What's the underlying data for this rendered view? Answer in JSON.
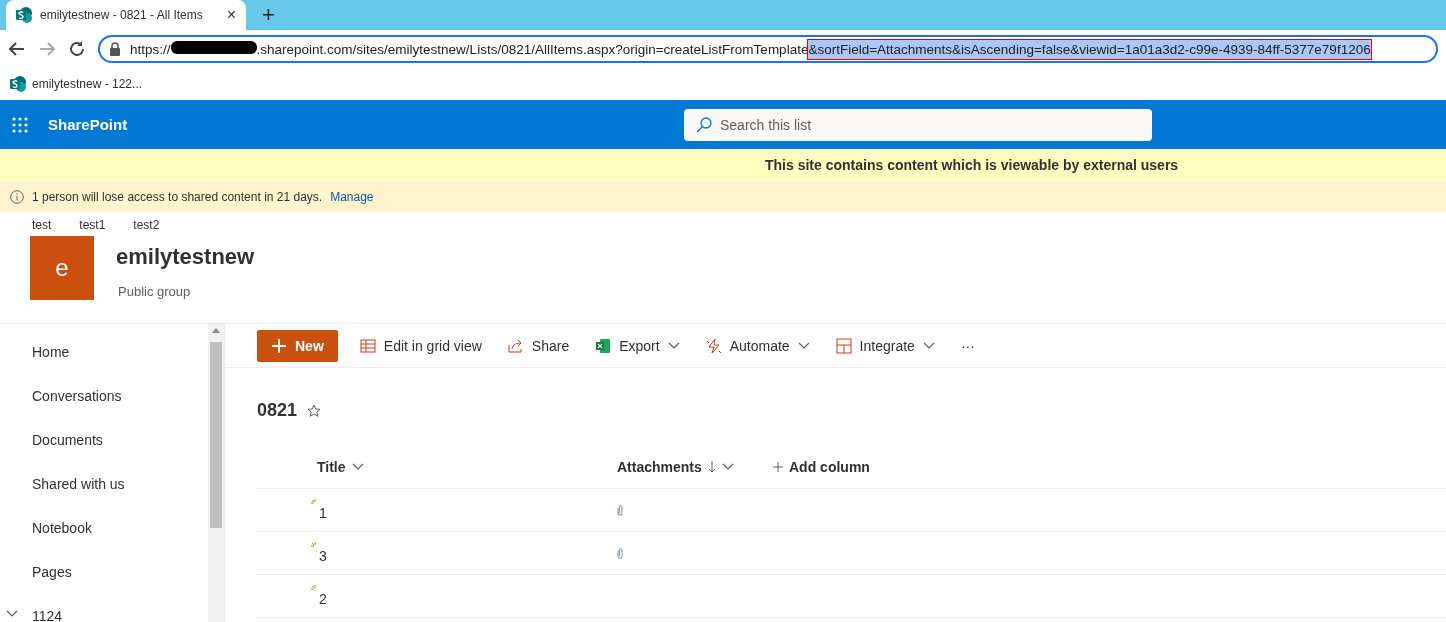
{
  "browser": {
    "tab_title": "emilytestnew - 0821 - All Items",
    "tab_close": "×",
    "new_tab": "+",
    "url": {
      "scheme": "https://",
      "host_rest": ".sharepoint.com/sites/emilytestnew/Lists/0821/AllItems.aspx?origin=createListFromTemplate",
      "selected_part": "&sortField=Attachments&isAscending=false&viewid=1a01a3d2-c99e-4939-84ff-5377e79f1206"
    },
    "bookmarks": [
      "emilytestnew - 122..."
    ]
  },
  "suite_bar": {
    "app_name": "SharePoint",
    "search": {
      "placeholder": "Search this list"
    }
  },
  "external_banner": "This site contains content which is viewable by external users",
  "notice": {
    "text": "1 person will lose access to shared content in 21 days.",
    "link": "Manage"
  },
  "hub_links": [
    "test",
    "test1",
    "test2"
  ],
  "site": {
    "logo_letter": "e",
    "title": "emilytestnew",
    "subtitle": "Public group"
  },
  "nav": [
    {
      "label": "Home",
      "kind": "link"
    },
    {
      "label": "Conversations",
      "kind": "link"
    },
    {
      "label": "Documents",
      "kind": "link"
    },
    {
      "label": "Shared with us",
      "kind": "link"
    },
    {
      "label": "Notebook",
      "kind": "link"
    },
    {
      "label": "Pages",
      "kind": "link"
    },
    {
      "label": "1124",
      "kind": "group"
    }
  ],
  "commands": [
    {
      "label": "New",
      "kind": "primary"
    },
    {
      "label": "Edit in grid view",
      "kind": "grid"
    },
    {
      "label": "Share",
      "kind": "share"
    },
    {
      "label": "Export",
      "kind": "excel",
      "menu": true
    },
    {
      "label": "Automate",
      "kind": "automate",
      "menu": true
    },
    {
      "label": "Integrate",
      "kind": "integrate",
      "menu": true
    },
    {
      "label": "···",
      "kind": "more"
    }
  ],
  "list": {
    "title": "0821",
    "columns": [
      {
        "label": "Title",
        "sorted": false
      },
      {
        "label": "Attachments",
        "sorted": true
      }
    ],
    "add_column": "Add column",
    "rows": [
      {
        "title": "1",
        "attachment": true
      },
      {
        "title": "3",
        "attachment": true
      },
      {
        "title": "2",
        "attachment": false
      }
    ]
  }
}
